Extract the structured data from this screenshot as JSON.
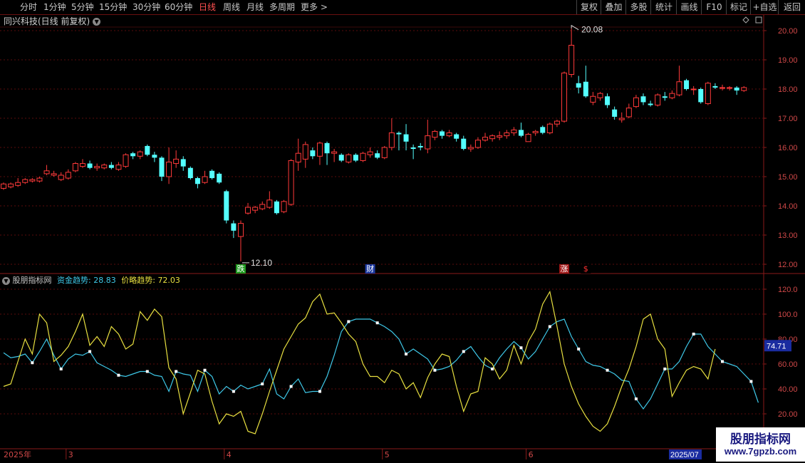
{
  "toolbar": {
    "periods": [
      "分时",
      "1分钟",
      "5分钟",
      "15分钟",
      "30分钟",
      "60分钟",
      "日线",
      "周线",
      "月线",
      "多周期",
      "更多"
    ],
    "active_period": "日线",
    "more_caret": ">",
    "right_buttons": [
      "复权",
      "叠加",
      "多股",
      "统计",
      "画线",
      "F10",
      "标记",
      "+自选",
      "返回"
    ]
  },
  "main": {
    "title": "同兴科技(日线 前复权)",
    "high_label": "20.08",
    "low_label": "12.10",
    "yaxis": [
      "20.00",
      "19.00",
      "18.00",
      "17.00",
      "16.00",
      "15.00",
      "14.00",
      "13.00",
      "12.00"
    ],
    "event_markers": [
      {
        "text": "跌",
        "color": "#1f9a1f",
        "text_color": "#ffffff",
        "idx": 33
      },
      {
        "text": "财",
        "color": "#1e3aa0",
        "text_color": "#ffffff",
        "idx": 51
      },
      {
        "text": "涨",
        "color": "#a01818",
        "text_color": "#ffffff",
        "idx": 78
      },
      {
        "text": "$",
        "color": "#000000",
        "text_color": "#ff3030",
        "idx": 81
      }
    ]
  },
  "indicator": {
    "name": "股朋指标网",
    "series": [
      {
        "label": "资金趋势:",
        "value": "28.83",
        "color": "#3ec8e8"
      },
      {
        "label": "价略趋势:",
        "value": "72.03",
        "color": "#e8e040"
      }
    ],
    "yaxis": [
      "120.0",
      "100.0",
      "80.00",
      "60.00",
      "40.00",
      "20.00"
    ],
    "current_value_tag": "74.71"
  },
  "xaxis": {
    "labels": [
      {
        "text": "2025年",
        "idx": 0
      },
      {
        "text": "3",
        "idx": 9
      },
      {
        "text": "4",
        "idx": 31
      },
      {
        "text": "5",
        "idx": 53
      },
      {
        "text": "6",
        "idx": 73
      }
    ],
    "current": "2025/07"
  },
  "watermark": {
    "title": "股朋指标网",
    "url": "www.7gpzb.com"
  },
  "colors": {
    "up": "#ff3a3a",
    "down": "#54ffff",
    "grid": "#5a0c0c",
    "axis": "#8a1a1a",
    "label": "#d04848"
  },
  "chart_data": {
    "type": "candlestick",
    "series_name": "同兴科技",
    "ylim": [
      11.9,
      20.3
    ],
    "candles": [
      [
        14.6,
        14.75,
        14.55,
        14.8
      ],
      [
        14.65,
        14.75,
        14.6,
        14.8
      ],
      [
        14.7,
        14.8,
        14.65,
        14.95
      ],
      [
        14.8,
        14.9,
        14.75,
        14.95
      ],
      [
        14.85,
        14.9,
        14.8,
        14.95
      ],
      [
        14.85,
        14.95,
        14.8,
        15.0
      ],
      [
        15.1,
        15.2,
        15.05,
        15.4
      ],
      [
        15.05,
        15.1,
        15.0,
        15.2
      ],
      [
        14.9,
        15.05,
        14.85,
        15.15
      ],
      [
        14.95,
        15.15,
        14.9,
        15.25
      ],
      [
        15.2,
        15.45,
        15.15,
        15.5
      ],
      [
        15.35,
        15.45,
        15.3,
        15.6
      ],
      [
        15.45,
        15.3,
        15.25,
        15.55
      ],
      [
        15.3,
        15.35,
        15.2,
        15.45
      ],
      [
        15.3,
        15.4,
        15.25,
        15.45
      ],
      [
        15.4,
        15.3,
        15.25,
        15.5
      ],
      [
        15.25,
        15.4,
        15.2,
        15.5
      ],
      [
        15.35,
        15.75,
        15.3,
        15.8
      ],
      [
        15.8,
        15.7,
        15.6,
        15.85
      ],
      [
        15.7,
        15.85,
        15.6,
        15.9
      ],
      [
        16.05,
        15.75,
        15.7,
        16.1
      ],
      [
        15.75,
        15.65,
        15.5,
        15.85
      ],
      [
        15.65,
        15.0,
        14.85,
        15.7
      ],
      [
        15.0,
        15.5,
        14.75,
        16.0
      ],
      [
        15.45,
        15.6,
        15.3,
        15.9
      ],
      [
        15.6,
        15.35,
        15.2,
        15.7
      ],
      [
        15.3,
        14.95,
        14.9,
        15.35
      ],
      [
        14.95,
        14.75,
        14.6,
        15.0
      ],
      [
        14.8,
        15.0,
        14.75,
        15.2
      ],
      [
        15.2,
        14.95,
        14.9,
        15.25
      ],
      [
        15.1,
        14.8,
        14.75,
        15.15
      ],
      [
        14.5,
        13.5,
        13.4,
        14.55
      ],
      [
        13.4,
        13.15,
        12.9,
        13.5
      ],
      [
        12.95,
        13.4,
        12.1,
        13.5
      ],
      [
        13.75,
        13.95,
        13.7,
        14.1
      ],
      [
        13.85,
        13.95,
        13.75,
        14.0
      ],
      [
        13.9,
        14.05,
        13.85,
        14.15
      ],
      [
        13.95,
        14.2,
        13.9,
        14.5
      ],
      [
        14.15,
        13.75,
        13.7,
        14.2
      ],
      [
        13.8,
        14.15,
        13.75,
        14.2
      ],
      [
        14.05,
        15.55,
        14.0,
        15.6
      ],
      [
        15.5,
        15.8,
        15.2,
        16.3
      ],
      [
        15.6,
        16.1,
        15.3,
        16.2
      ],
      [
        15.9,
        15.7,
        15.6,
        16.0
      ],
      [
        15.7,
        16.15,
        15.4,
        16.2
      ],
      [
        16.15,
        15.8,
        15.4,
        16.2
      ],
      [
        15.8,
        15.85,
        15.5,
        15.95
      ],
      [
        15.75,
        15.55,
        15.5,
        15.8
      ],
      [
        15.5,
        15.75,
        15.45,
        15.8
      ],
      [
        15.75,
        15.55,
        15.5,
        15.8
      ],
      [
        15.55,
        15.8,
        15.5,
        15.85
      ],
      [
        15.75,
        15.85,
        15.65,
        16.0
      ],
      [
        15.8,
        15.65,
        15.6,
        15.9
      ],
      [
        15.65,
        16.0,
        15.6,
        16.05
      ],
      [
        16.0,
        16.5,
        15.9,
        17.0
      ],
      [
        16.5,
        16.45,
        15.9,
        16.55
      ],
      [
        16.45,
        16.2,
        15.9,
        16.8
      ],
      [
        16.0,
        15.95,
        15.6,
        16.1
      ],
      [
        16.05,
        16.0,
        15.9,
        16.15
      ],
      [
        15.95,
        16.4,
        15.8,
        16.95
      ],
      [
        16.35,
        16.55,
        16.25,
        16.6
      ],
      [
        16.55,
        16.4,
        16.3,
        16.6
      ],
      [
        16.4,
        16.5,
        16.35,
        16.6
      ],
      [
        16.45,
        16.3,
        16.2,
        16.5
      ],
      [
        16.3,
        15.95,
        15.9,
        16.4
      ],
      [
        15.95,
        16.0,
        15.85,
        16.1
      ],
      [
        16.0,
        16.25,
        15.95,
        16.35
      ],
      [
        16.25,
        16.35,
        16.2,
        16.5
      ],
      [
        16.3,
        16.4,
        16.2,
        16.45
      ],
      [
        16.35,
        16.4,
        16.25,
        16.55
      ],
      [
        16.4,
        16.5,
        16.3,
        16.6
      ],
      [
        16.5,
        16.6,
        16.4,
        16.7
      ],
      [
        16.6,
        16.4,
        16.35,
        16.85
      ],
      [
        16.2,
        16.45,
        16.2,
        16.5
      ],
      [
        16.5,
        16.55,
        16.4,
        16.6
      ],
      [
        16.7,
        16.5,
        16.45,
        16.75
      ],
      [
        16.5,
        16.8,
        16.45,
        16.85
      ],
      [
        16.8,
        16.9,
        16.7,
        16.95
      ],
      [
        16.9,
        18.55,
        16.85,
        18.6
      ],
      [
        18.5,
        19.5,
        18.4,
        20.08
      ],
      [
        18.2,
        18.05,
        17.85,
        18.45
      ],
      [
        18.25,
        17.75,
        17.7,
        18.8
      ],
      [
        17.55,
        17.75,
        17.45,
        17.9
      ],
      [
        17.7,
        17.85,
        17.6,
        17.9
      ],
      [
        17.75,
        17.45,
        17.35,
        17.85
      ],
      [
        17.3,
        17.05,
        16.95,
        17.4
      ],
      [
        16.95,
        17.0,
        16.85,
        17.2
      ],
      [
        17.05,
        17.35,
        17.0,
        17.5
      ],
      [
        17.4,
        17.7,
        17.35,
        17.8
      ],
      [
        17.75,
        17.55,
        17.45,
        17.85
      ],
      [
        17.5,
        17.45,
        17.4,
        17.6
      ],
      [
        17.45,
        17.8,
        17.4,
        17.85
      ],
      [
        17.75,
        17.7,
        17.6,
        17.9
      ],
      [
        17.7,
        17.85,
        17.65,
        17.95
      ],
      [
        17.8,
        18.25,
        17.75,
        18.8
      ],
      [
        18.3,
        18.0,
        17.95,
        18.35
      ],
      [
        18.0,
        18.0,
        17.8,
        18.1
      ],
      [
        18.0,
        17.55,
        17.5,
        18.05
      ],
      [
        17.5,
        18.2,
        17.45,
        18.25
      ],
      [
        18.1,
        18.05,
        18.0,
        18.2
      ],
      [
        18.05,
        18.05,
        17.95,
        18.15
      ],
      [
        18.05,
        18.05,
        17.95,
        18.1
      ],
      [
        18.05,
        17.95,
        17.8,
        18.1
      ],
      [
        17.95,
        18.05,
        17.9,
        18.1
      ]
    ],
    "indicator_lines": {
      "ylim": [
        8,
        130
      ],
      "资金趋势": [
        69,
        65,
        66,
        68,
        61,
        70,
        80,
        67,
        56,
        64,
        68,
        67,
        70,
        61,
        58,
        55,
        51,
        50,
        52,
        54,
        54,
        51,
        50,
        38,
        54,
        52,
        51,
        38,
        55,
        50,
        36,
        42,
        38,
        43,
        40,
        42,
        44,
        56,
        36,
        32,
        42,
        48,
        37,
        38,
        38,
        50,
        67,
        86,
        94,
        96,
        96,
        96,
        93,
        90,
        86,
        80,
        68,
        72,
        68,
        64,
        55,
        56,
        58,
        63,
        70,
        74,
        66,
        59,
        56,
        65,
        72,
        78,
        73,
        64,
        70,
        80,
        90,
        94,
        96,
        82,
        72,
        62,
        59,
        58,
        55,
        52,
        47,
        46,
        32,
        24,
        32,
        44,
        56,
        56,
        62,
        74,
        84,
        84,
        74,
        68,
        62,
        60,
        58,
        52,
        46,
        29
      ],
      "价略趋势": [
        42,
        44,
        62,
        80,
        68,
        100,
        93,
        62,
        67,
        74,
        86,
        100,
        75,
        82,
        74,
        90,
        84,
        72,
        76,
        102,
        95,
        104,
        98,
        57,
        48,
        20,
        37,
        55,
        52,
        30,
        12,
        20,
        18,
        22,
        6,
        4,
        20,
        38,
        55,
        72,
        82,
        92,
        97,
        110,
        116,
        100,
        101,
        93,
        84,
        78,
        60,
        50,
        50,
        45,
        55,
        52,
        40,
        45,
        33,
        49,
        60,
        68,
        66,
        42,
        22,
        36,
        38,
        65,
        60,
        48,
        55,
        75,
        60,
        78,
        88,
        108,
        118,
        90,
        60,
        42,
        28,
        18,
        10,
        6,
        12,
        26,
        42,
        56,
        74,
        96,
        100,
        80,
        72,
        34,
        45,
        55,
        58,
        56,
        48,
        72
      ]
    }
  }
}
